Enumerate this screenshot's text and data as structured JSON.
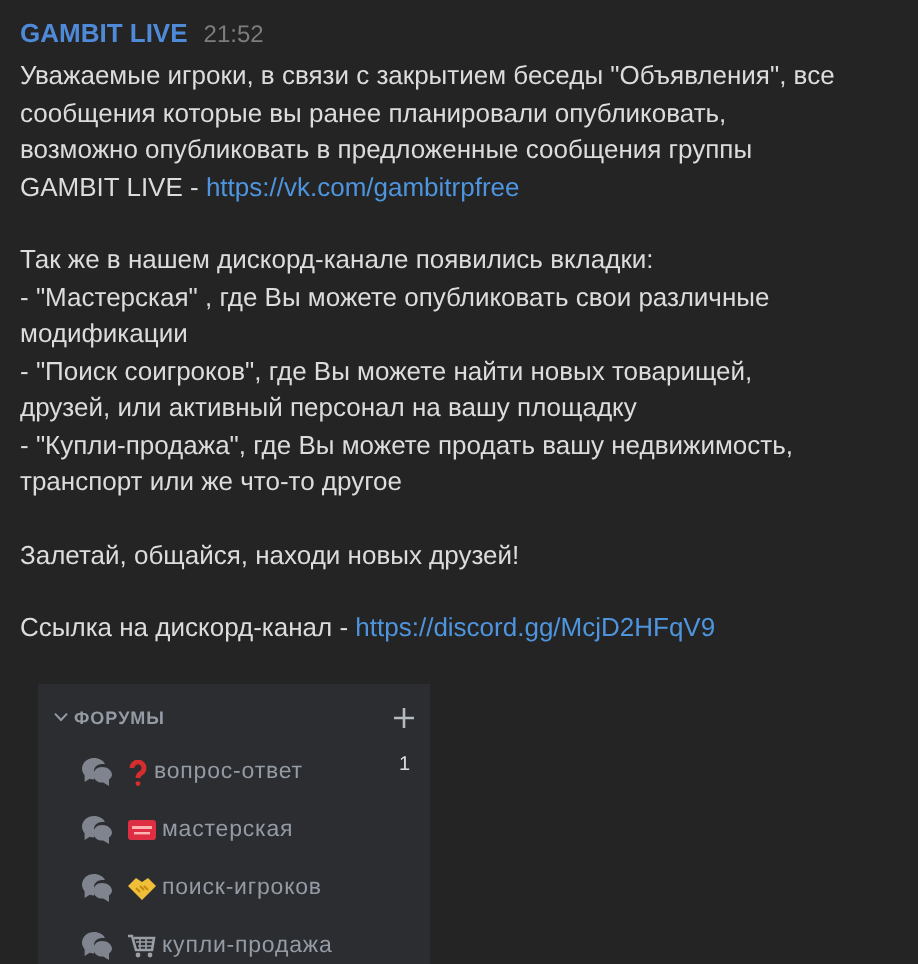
{
  "message": {
    "author": "GAMBIT LIVE",
    "time": "21:52",
    "paragraphs": [
      {
        "text": "Уважаемые игроки, в связи с закрытием беседы \"Объявления\", все\nсообщения которые вы ранее планировали опубликовать,\nвозможно опубликовать в предложенные сообщения группы\nGAMBIT LIVE - ",
        "link": "https://vk.com/gambitrpfree"
      },
      {
        "text": "Так же в нашем дискорд-канале появились вкладки:\n- \"Мастерская\" , где Вы можете опубликовать свои различные\nмодификации\n- \"Поиск соигроков\", где Вы можете найти новых товарищей,\nдрузей, или активный персонал на вашу площадку\n- \"Купли-продажа\", где Вы можете продать вашу недвижимость,\nтранспорт или же что-то другое"
      },
      {
        "text": "Залетай, общайся, находи новых друзей!"
      },
      {
        "text": "Ссылка на дискорд-канал - ",
        "link": "https://discord.gg/McjD2HFqV9"
      }
    ]
  },
  "forums": {
    "title": "ФОРУМЫ",
    "expanded": true,
    "channels": [
      {
        "kind": "question",
        "name": "вопрос-ответ",
        "count": "1"
      },
      {
        "kind": "pager",
        "name": "мастерская"
      },
      {
        "kind": "handshake",
        "name": "поиск-игроков"
      },
      {
        "kind": "cart",
        "name": "купли-продажа"
      }
    ]
  }
}
